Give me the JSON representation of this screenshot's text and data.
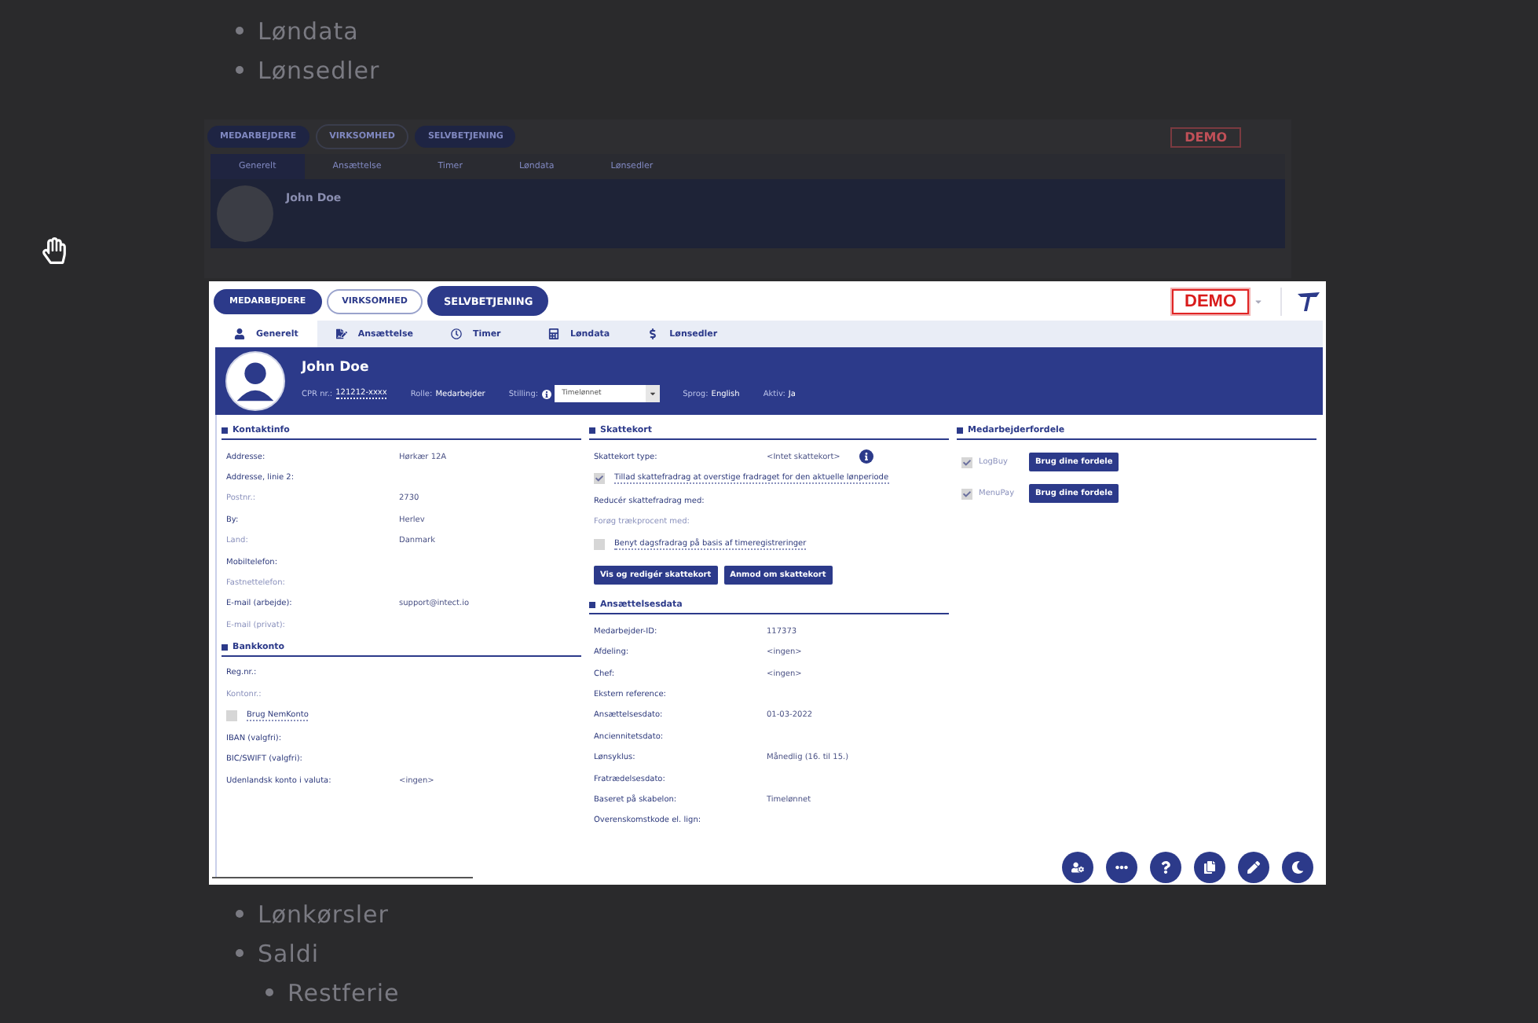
{
  "document": {
    "list_top": [
      {
        "label": "Løndata"
      },
      {
        "label": "Lønsedler"
      }
    ],
    "list_bottom": [
      {
        "label": "Lønkørsler"
      },
      {
        "label": "Saldi",
        "children": [
          {
            "label": "Restferie"
          }
        ]
      }
    ]
  },
  "background_preview": {
    "nav_buttons": [
      {
        "label": "MEDARBEJDERE",
        "kind": "filled"
      },
      {
        "label": "VIRKSOMHED",
        "kind": "outline"
      },
      {
        "label": "SELVBETJENING",
        "kind": "filled"
      }
    ],
    "badge": "DEMO",
    "tabs": [
      {
        "label": "Generelt",
        "selected": true
      },
      {
        "label": "Ansættelse",
        "selected": false
      },
      {
        "label": "Timer",
        "selected": false
      },
      {
        "label": "Løndata",
        "selected": false
      },
      {
        "label": "Lønsedler",
        "selected": false
      }
    ],
    "name": "John Doe"
  },
  "screenshot": {
    "nav_buttons": [
      {
        "label": "MEDARBEJDERE",
        "kind": "filled"
      },
      {
        "label": "VIRKSOMHED",
        "kind": "outline"
      },
      {
        "label": "SELVBETJENING",
        "kind": "filled"
      }
    ],
    "badge": "DEMO",
    "tabs": [
      {
        "label": "Generelt",
        "selected": true
      },
      {
        "label": "Ansættelse",
        "selected": false
      },
      {
        "label": "Timer",
        "selected": false
      },
      {
        "label": "Løndata",
        "selected": false
      },
      {
        "label": "Lønsedler",
        "selected": false
      }
    ],
    "profile": {
      "name": "John Doe",
      "fields": [
        {
          "kind": "text",
          "label": "CPR nr.:",
          "value": "121212-xxxx"
        },
        {
          "kind": "text",
          "label": "Rolle:",
          "value": "Medarbejder"
        },
        {
          "kind": "select",
          "label": "Stilling:",
          "value": "Timelønnet"
        },
        {
          "kind": "text",
          "label": "Sprog:",
          "value": "English"
        },
        {
          "kind": "text",
          "label": "Aktiv:",
          "value": "Ja"
        }
      ]
    },
    "columns": [
      [
        {
          "title": "Kontaktinfo",
          "items": [
            {
              "kind": "row",
              "label": "Addresse:",
              "value": "Hørkær 12A",
              "muted": false
            },
            {
              "kind": "row",
              "label": "Addresse, linie 2:",
              "muted": false
            },
            {
              "kind": "row",
              "label": "Postnr.:",
              "value": "2730",
              "muted": true
            },
            {
              "kind": "row",
              "label": "By:",
              "value": "Herlev",
              "muted": false
            },
            {
              "kind": "row",
              "label": "Land:",
              "value": "Danmark",
              "muted": true
            },
            {
              "kind": "row",
              "label": "Mobiltelefon:",
              "muted": false
            },
            {
              "kind": "row",
              "label": "Fastnettelefon:",
              "muted": true
            },
            {
              "kind": "row",
              "label": "E-mail (arbejde):",
              "value": "support@intect.io",
              "muted": false
            },
            {
              "kind": "row",
              "label": "E-mail (privat):",
              "muted": true
            }
          ]
        },
        {
          "title": "Bankkonto",
          "items": [
            {
              "kind": "row",
              "label": "Reg.nr.:",
              "muted": false
            },
            {
              "kind": "row",
              "label": "Kontonr.:",
              "muted": true
            },
            {
              "kind": "check",
              "label": "Brug NemKonto",
              "checked": false
            },
            {
              "kind": "row",
              "label": "IBAN (valgfri):",
              "muted": false
            },
            {
              "kind": "row",
              "label": "BIC/SWIFT (valgfri):",
              "muted": false
            },
            {
              "kind": "row",
              "label": "Udenlandsk konto i valuta:",
              "value": "<ingen>",
              "muted": false
            }
          ]
        }
      ],
      [
        {
          "title": "Skattekort",
          "items": [
            {
              "kind": "info",
              "label": "Skattekort type:",
              "value": "<Intet skattekort>",
              "muted": false
            },
            {
              "kind": "check",
              "label": "Tillad skattefradrag at overstige fradraget for den aktuelle lønperiode",
              "checked": true
            },
            {
              "kind": "row",
              "label": "Reducér skattefradrag med:",
              "muted": false
            },
            {
              "kind": "row",
              "label": "Forøg trækprocent med:",
              "muted": true
            },
            {
              "kind": "check",
              "label": "Benyt dagsfradrag på basis af timeregistreringer",
              "checked": false
            },
            {
              "kind": "buttons",
              "buttons": [
                "Vis og redigér skattekort",
                "Anmod om skattekort"
              ]
            }
          ]
        },
        {
          "title": "Ansættelsesdata",
          "items": [
            {
              "kind": "row",
              "label": "Medarbejder-ID:",
              "value": "117373",
              "muted": false
            },
            {
              "kind": "row",
              "label": "Afdeling:",
              "value": "<ingen>",
              "muted": false
            },
            {
              "kind": "row",
              "label": "Chef:",
              "value": "<ingen>",
              "muted": false
            },
            {
              "kind": "row",
              "label": "Ekstern reference:",
              "muted": false
            },
            {
              "kind": "row",
              "label": "Ansættelsesdato:",
              "value": "01-03-2022",
              "muted": false
            },
            {
              "kind": "row",
              "label": "Anciennitetsdato:",
              "muted": false
            },
            {
              "kind": "row",
              "label": "Lønsyklus:",
              "value": "Månedlig (16. til 15.)",
              "muted": false
            },
            {
              "kind": "row",
              "label": "Fratrædelsesdato:",
              "muted": false
            },
            {
              "kind": "row",
              "label": "Baseret på skabelon:",
              "value": "Timelønnet",
              "muted": false
            },
            {
              "kind": "row",
              "label": "Overenskomstkode el. lign:",
              "muted": false
            }
          ]
        }
      ],
      [
        {
          "title": "Medarbejderfordele",
          "items": [
            {
              "kind": "benefit",
              "label": "LogBuy",
              "checked": true,
              "button": "Brug dine fordele"
            },
            {
              "kind": "benefit",
              "label": "MenuPay",
              "checked": true,
              "button": "Brug dine fordele"
            }
          ]
        }
      ]
    ]
  }
}
